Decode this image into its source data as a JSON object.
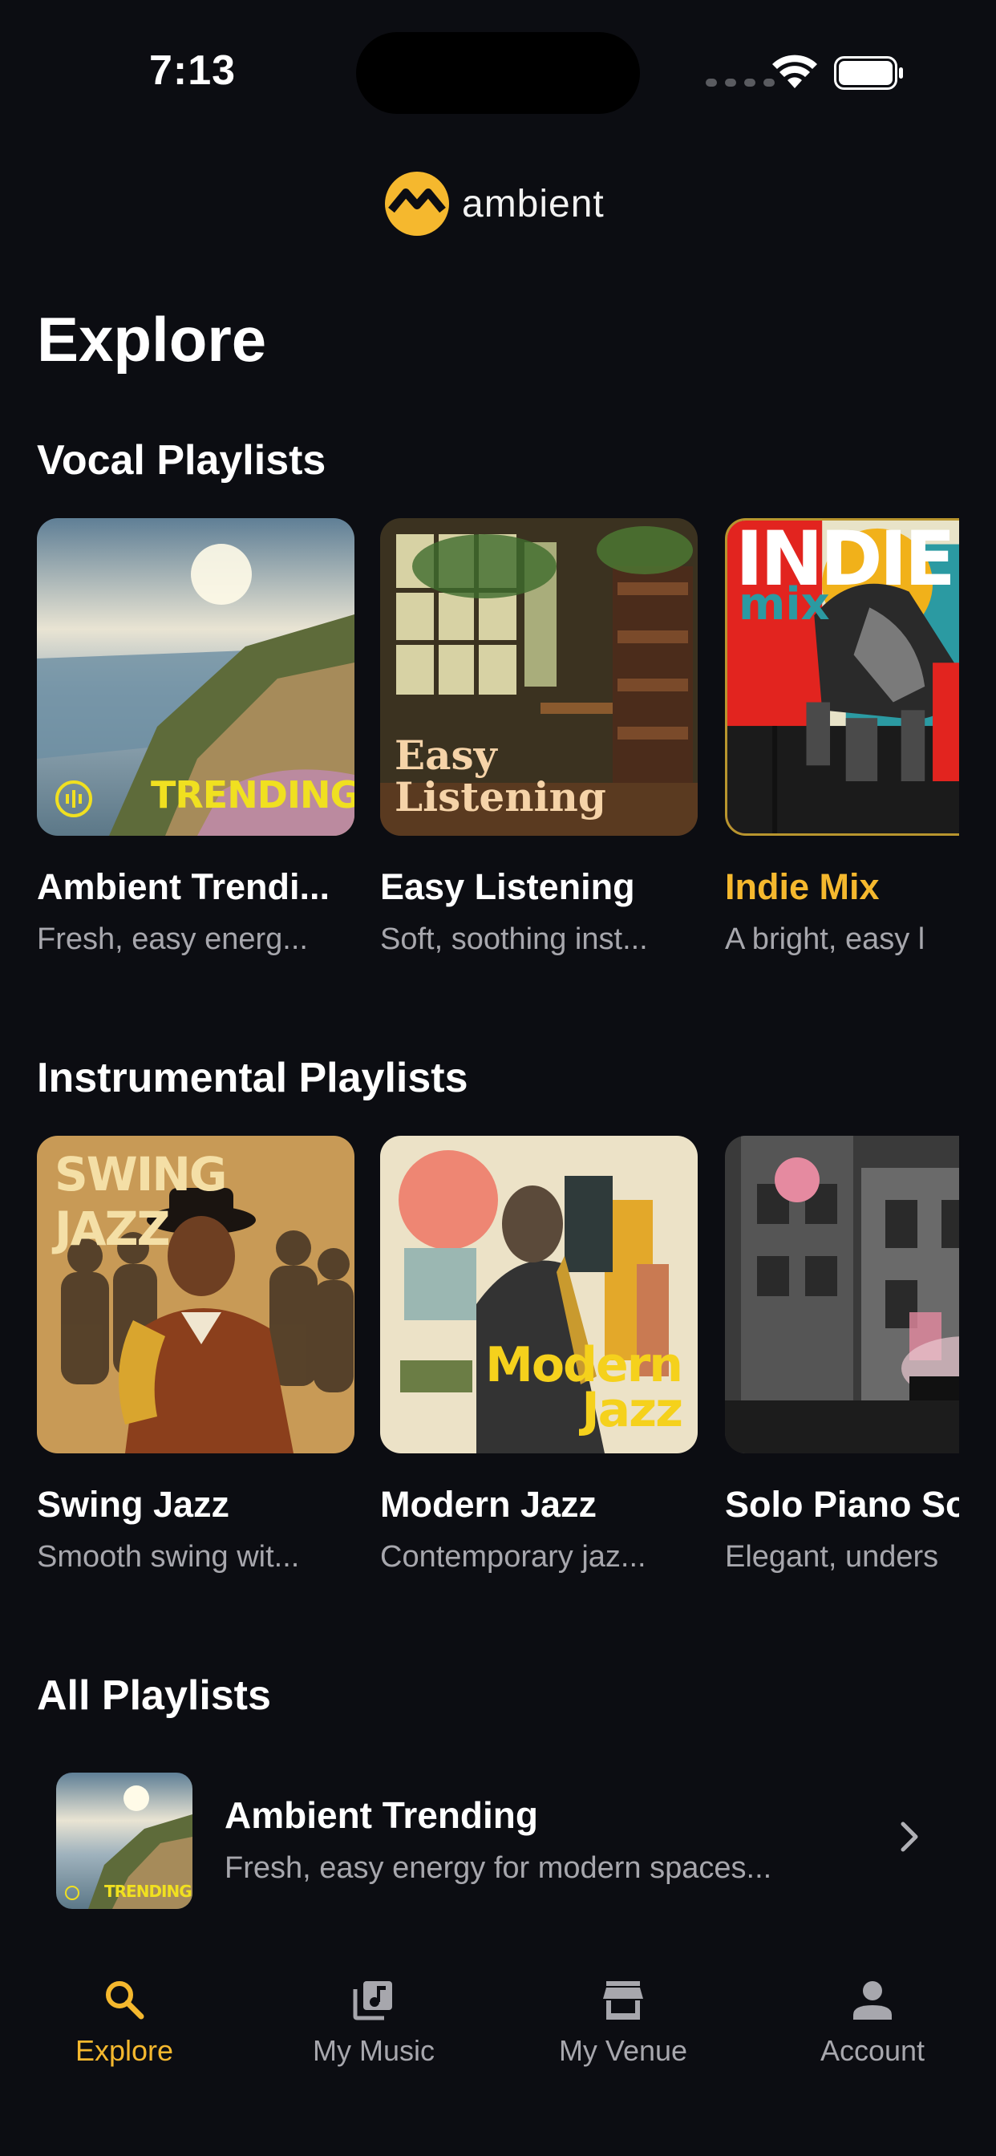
{
  "status_bar": {
    "time": "7:13"
  },
  "brand": {
    "name": "ambient",
    "accent_color": "#f5b82e"
  },
  "page_title": "Explore",
  "sections": {
    "vocal": {
      "title": "Vocal Playlists",
      "items": [
        {
          "title": "Ambient Trendi...",
          "subtitle": "Fresh, easy energ...",
          "cover_text": "TRENDING",
          "icon": "soundwave-icon"
        },
        {
          "title": "Easy Listening",
          "subtitle": "Soft, soothing inst...",
          "cover_text": "Easy Listening"
        },
        {
          "title": "Indie Mix",
          "subtitle": "A bright, easy l",
          "cover_text_1": "INDIE",
          "cover_text_2": "mix",
          "selected": true
        }
      ]
    },
    "instrumental": {
      "title": "Instrumental Playlists",
      "items": [
        {
          "title": "Swing Jazz",
          "subtitle": "Smooth swing wit...",
          "cover_text": "SWING JAZZ"
        },
        {
          "title": "Modern Jazz",
          "subtitle": "Contemporary jaz...",
          "cover_text_1": "Modern",
          "cover_text_2": "Jazz"
        },
        {
          "title": "Solo Piano So",
          "subtitle": "Elegant, unders"
        }
      ]
    },
    "all": {
      "title": "All Playlists",
      "items": [
        {
          "title": "Ambient Trending",
          "subtitle": "Fresh, easy energy for modern spaces...",
          "cover_text": "TRENDING"
        }
      ]
    }
  },
  "tab_bar": {
    "tabs": [
      {
        "label": "Explore",
        "icon": "search-icon",
        "active": true
      },
      {
        "label": "My Music",
        "icon": "music-library-icon",
        "active": false
      },
      {
        "label": "My Venue",
        "icon": "storefront-icon",
        "active": false
      },
      {
        "label": "Account",
        "icon": "person-icon",
        "active": false
      }
    ]
  }
}
